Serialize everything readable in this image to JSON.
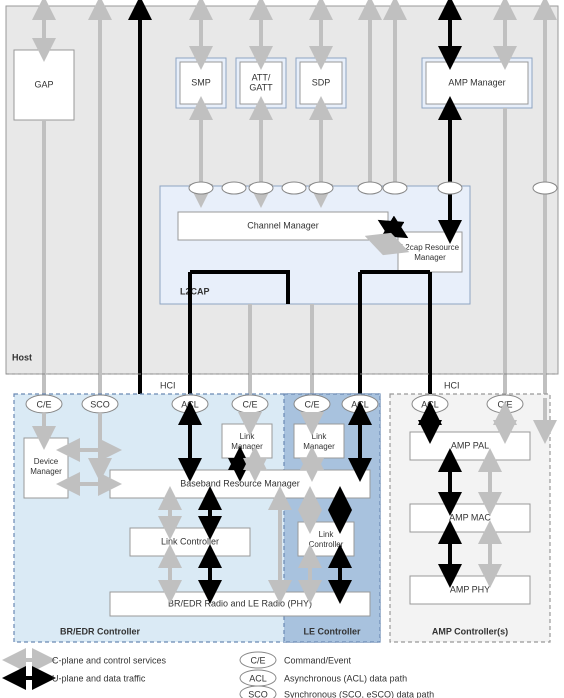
{
  "host_label": "Host",
  "gap": "GAP",
  "smp": "SMP",
  "att_gatt": "ATT/\nGATT",
  "sdp": "SDP",
  "amp_manager": "AMP Manager",
  "l2cap": {
    "title": "L2CAP",
    "channel_manager": "Channel Manager",
    "resource_manager": "L2cap Resource\nManager"
  },
  "hci": "HCI",
  "bredr": {
    "title": "BR/EDR Controller",
    "device_manager": "Device\nManager",
    "link_manager": "Link\nManager",
    "baseband": "Baseband Resource Manager",
    "link_controller": "Link Controller",
    "radio": "BR/EDR Radio and LE Radio (PHY)"
  },
  "le": {
    "title": "LE Controller",
    "link_manager": "Link\nManager",
    "link_controller": "Link\nController"
  },
  "amp": {
    "title": "AMP Controller(s)",
    "pal": "AMP PAL",
    "mac": "AMP MAC",
    "phy": "AMP PHY"
  },
  "pills": {
    "ce": "C/E",
    "sco": "SCO",
    "acl": "ACL"
  },
  "legend": {
    "cplane": "C-plane and control services",
    "uplane": "U-plane and data traffic",
    "ce": "Command/Event",
    "acl": "Asynchronous (ACL) data path",
    "sco": "Synchronous (SCO, eSCO) data path"
  }
}
